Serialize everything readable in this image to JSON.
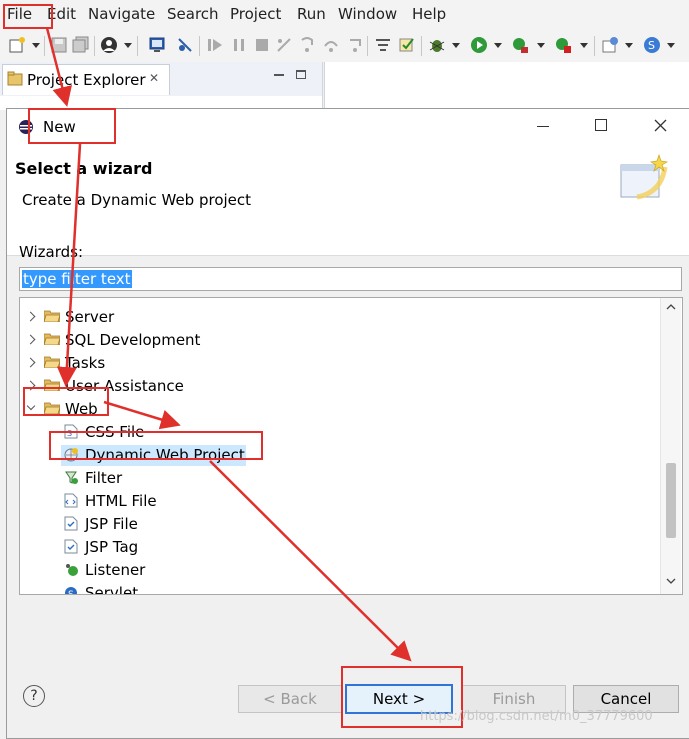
{
  "menubar": {
    "items": [
      "File",
      "Edit",
      "Navigate",
      "Search",
      "Project",
      "Run",
      "Window",
      "Help"
    ]
  },
  "explorer": {
    "tab_label": "Project Explorer",
    "close_glyph": "✕"
  },
  "dialog": {
    "title": "New",
    "header_title": "Select a wizard",
    "header_desc": "Create a Dynamic Web project",
    "wizards_label": "Wizards:",
    "filter_value": "type filter text",
    "tree": [
      {
        "label": "Server",
        "type": "folder",
        "expanded": false
      },
      {
        "label": "SQL Development",
        "type": "folder",
        "expanded": false
      },
      {
        "label": "Tasks",
        "type": "folder",
        "expanded": false
      },
      {
        "label": "User Assistance",
        "type": "folder",
        "expanded": false
      },
      {
        "label": "Web",
        "type": "folder",
        "expanded": true
      },
      {
        "label": "CSS File",
        "type": "item"
      },
      {
        "label": "Dynamic Web Project",
        "type": "item",
        "selected": true
      },
      {
        "label": "Filter",
        "type": "item"
      },
      {
        "label": "HTML File",
        "type": "item"
      },
      {
        "label": "JSP File",
        "type": "item"
      },
      {
        "label": "JSP Tag",
        "type": "item"
      },
      {
        "label": "Listener",
        "type": "item"
      },
      {
        "label": "Servlet",
        "type": "item"
      }
    ],
    "buttons": {
      "help": "?",
      "back": "< Back",
      "next": "Next >",
      "finish": "Finish",
      "cancel": "Cancel"
    }
  },
  "watermark": "https://blog.csdn.net/m0_37779600",
  "colors": {
    "annotation": "#e0302c",
    "selection": "#cce8ff",
    "filter_highlight": "#3399ff"
  }
}
